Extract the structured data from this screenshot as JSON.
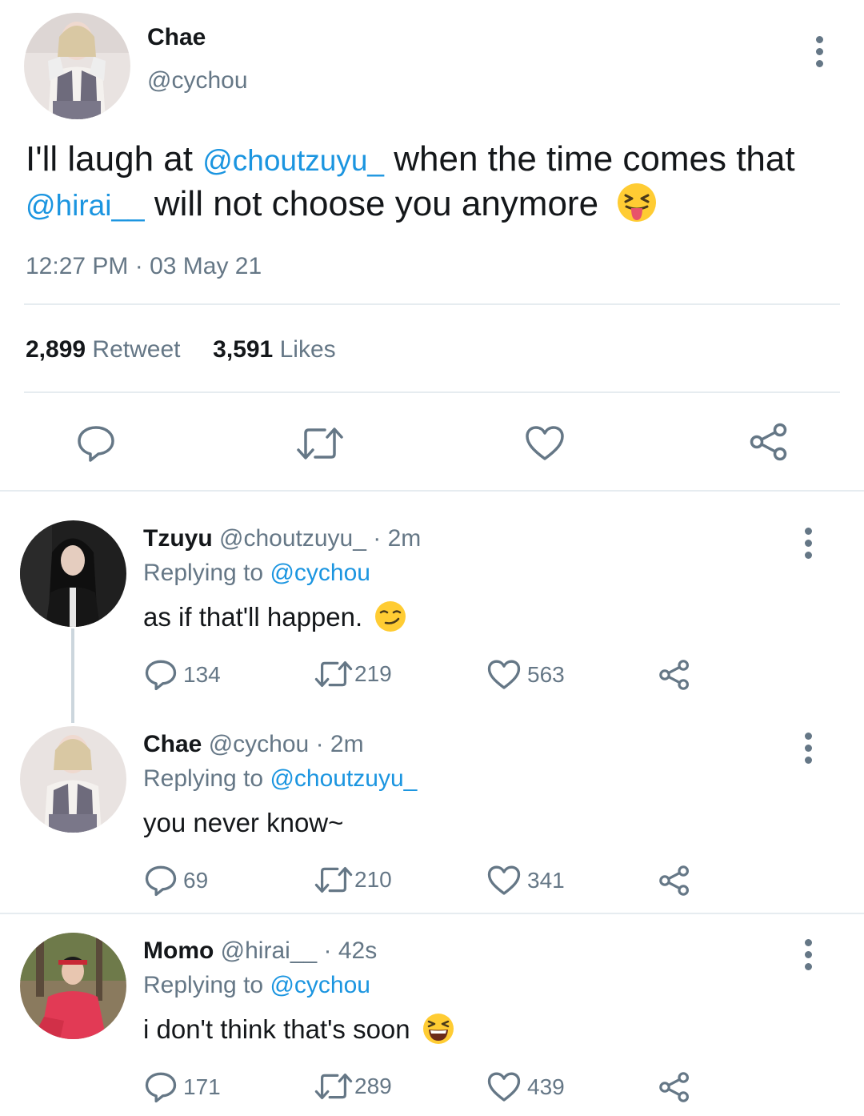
{
  "main_tweet": {
    "display_name": "Chae",
    "handle": "@cychou",
    "text_part1": "I'll laugh at ",
    "mention1": "@choutzuyu_",
    "text_part2": " when the time comes that",
    "mention2": "@hirai__",
    "text_part3": " will not choose you anymore",
    "emoji": "squinting-face-with-tongue",
    "timestamp": "12:27 PM · 03 May 21",
    "retweets": "2,899",
    "retweets_label": "Retweet",
    "likes": "3,591",
    "likes_label": "Likes"
  },
  "replies": [
    {
      "display_name": "Tzuyu",
      "handle": "@choutzuyu_",
      "time": "· 2m",
      "replying_label": "Replying to",
      "replying_to": "@cychou",
      "text": "as if that'll happen.",
      "emoji": "smirking-face",
      "replies": "134",
      "retweets": "219",
      "likes": "563"
    },
    {
      "display_name": "Chae",
      "handle": "@cychou",
      "time": "· 2m",
      "replying_label": "Replying to",
      "replying_to": "@choutzuyu_",
      "text": "you never know~",
      "emoji": "",
      "replies": "69",
      "retweets": "210",
      "likes": "341"
    },
    {
      "display_name": "Momo",
      "handle": "@hirai__",
      "time": "· 42s",
      "replying_label": "Replying to",
      "replying_to": "@cychou",
      "text": "i don't think that's soon",
      "emoji": "grinning-squinting-face",
      "replies": "171",
      "retweets": "289",
      "likes": "439"
    }
  ],
  "colors": {
    "link": "#1b95e0",
    "muted": "#657786",
    "divider": "#e6ecf0",
    "emoji_yellow": "#ffcc33"
  }
}
